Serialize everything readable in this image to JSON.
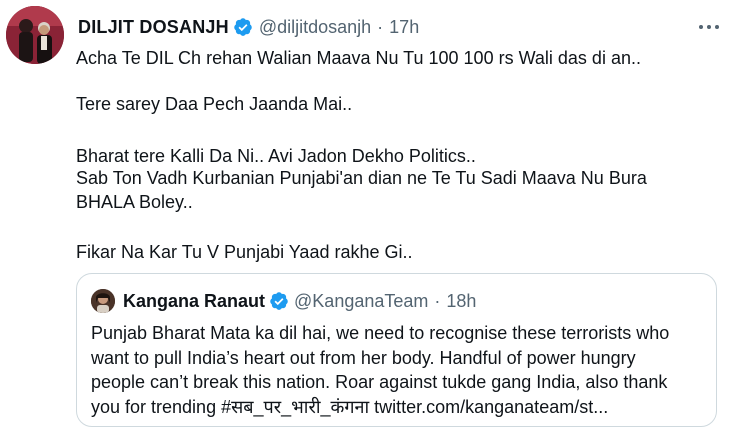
{
  "tweet": {
    "author_name": "DILJIT DOSANJH",
    "handle": "@diljitdosanjh",
    "separator": "·",
    "time": "17h",
    "more_icon": "more-horizontal-icon",
    "verified_icon": "verified-badge-icon",
    "paragraphs": [
      "Acha Te DIL Ch rehan Walian Maava Nu Tu 100 100 rs Wali das di an..",
      "Tere sarey Daa Pech Jaanda Mai..",
      "Bharat tere Kalli Da Ni.. Avi Jadon Dekho Politics..",
      "Sab Ton Vadh Kurbanian Punjabi'an dian ne Te Tu Sadi Maava Nu Bura",
      "BHALA Boley..",
      "Fikar Na Kar Tu V Punjabi Yaad rakhe Gi.."
    ]
  },
  "quote": {
    "author_name": "Kangana Ranaut",
    "handle": "@KanganaTeam",
    "separator": "·",
    "time": "18h",
    "lines": [
      "Punjab Bharat Mata ka dil hai, we need to recognise these terrorists who",
      "want to pull India’s heart out from her body. Handful of power hungry",
      "people can’t break this nation. Roar against tukde gang India, also thank",
      "you for trending #सब_पर_भारी_कंगना twitter.com/kanganateam/st..."
    ]
  },
  "colors": {
    "text": "#0f1419",
    "secondary": "#536471",
    "verified": "#1d9bf0",
    "border": "#cfd9de"
  }
}
